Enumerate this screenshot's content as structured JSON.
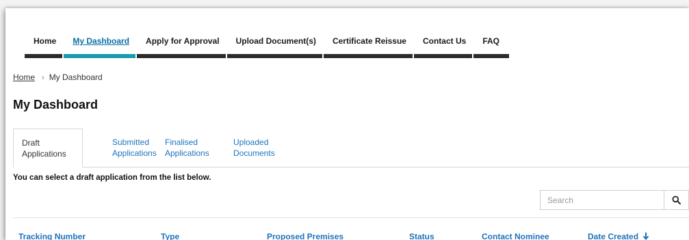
{
  "nav": {
    "items": [
      {
        "label": "Home"
      },
      {
        "label": "My Dashboard",
        "active": true
      },
      {
        "label": "Apply for Approval"
      },
      {
        "label": "Upload Document(s)"
      },
      {
        "label": "Certificate Reissue"
      },
      {
        "label": "Contact Us"
      },
      {
        "label": "FAQ"
      }
    ]
  },
  "breadcrumb": {
    "home": "Home",
    "separator": "›",
    "current": "My Dashboard"
  },
  "page_title": "My Dashboard",
  "tabs": [
    {
      "line1": "Draft",
      "line2": "Applications",
      "active": true
    },
    {
      "line1": "Submitted",
      "line2": "Applications"
    },
    {
      "line1": "Finalised",
      "line2": "Applications"
    },
    {
      "line1": "Uploaded",
      "line2": "Documents"
    }
  ],
  "helper_text": "You can select a draft application from the list below.",
  "search": {
    "placeholder": "Search",
    "value": "",
    "icon": "search-icon"
  },
  "table": {
    "columns": [
      "Tracking Number",
      "Type",
      "Proposed Premises",
      "Status",
      "Contact Nominee",
      "Date Created"
    ],
    "sort_icon": "arrow-down-icon"
  },
  "colors": {
    "accent": "#1b9ab0",
    "link": "#1c73be",
    "nav_bar": "#2b2b2b"
  }
}
